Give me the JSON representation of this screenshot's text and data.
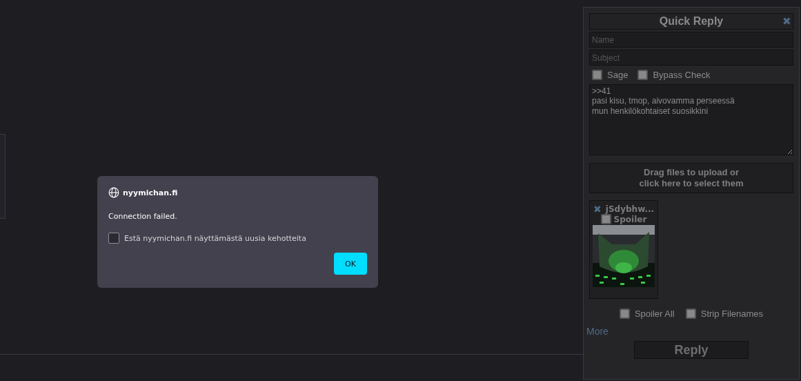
{
  "dialog": {
    "site": "nyymichan.fi",
    "message": "Connection failed.",
    "checkbox": {
      "label": "Estä nyymichan.fi näyttämästä uusia kehotteita",
      "checked": false
    },
    "button": "OK"
  },
  "quick_reply": {
    "title": "Quick Reply",
    "close": "✖",
    "name_field": {
      "placeholder": "Name"
    },
    "subject_field": {
      "placeholder": "Subject"
    },
    "options": [
      {
        "label": "Sage",
        "checked": false
      },
      {
        "label": "Bypass Check",
        "checked": false
      }
    ],
    "message": ">>41\npasi kisu, tmop, aivovamma perseessä\nmun henkilökohtaiset suosikkini",
    "dropzone": [
      "Drag files to upload or",
      "click here to select them"
    ],
    "files": [
      {
        "remove": "✖",
        "name": "jSdybhw...",
        "spoiler": {
          "label": "Spoiler",
          "checked": false
        },
        "kind": "picture"
      }
    ],
    "file_options": [
      {
        "label": "Spoiler All",
        "checked": false
      },
      {
        "label": "Strip Filenames",
        "checked": false
      }
    ],
    "more": "More",
    "submit": "Reply"
  }
}
